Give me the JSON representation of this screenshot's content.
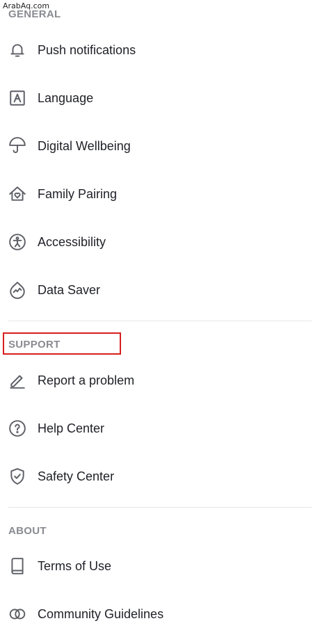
{
  "watermark": "ArabAq.com",
  "sections": {
    "general": {
      "title": "GENERAL",
      "items": [
        {
          "label": "Push notifications",
          "icon": "bell-icon"
        },
        {
          "label": "Language",
          "icon": "language-icon"
        },
        {
          "label": "Digital Wellbeing",
          "icon": "umbrella-icon"
        },
        {
          "label": "Family Pairing",
          "icon": "house-heart-icon"
        },
        {
          "label": "Accessibility",
          "icon": "accessibility-icon"
        },
        {
          "label": "Data Saver",
          "icon": "data-saver-icon"
        }
      ]
    },
    "support": {
      "title": "SUPPORT",
      "items": [
        {
          "label": "Report a problem",
          "icon": "pencil-icon"
        },
        {
          "label": "Help Center",
          "icon": "question-circle-icon"
        },
        {
          "label": "Safety Center",
          "icon": "shield-check-icon"
        }
      ]
    },
    "about": {
      "title": "ABOUT",
      "items": [
        {
          "label": "Terms of Use",
          "icon": "book-icon"
        },
        {
          "label": "Community Guidelines",
          "icon": "overlapping-circles-icon"
        }
      ]
    }
  },
  "colors": {
    "section_header": "#8a8b91",
    "text": "#1f2027",
    "icon": "#5e5f66",
    "divider": "#e6e6e8",
    "highlight": "#d81e1e"
  }
}
